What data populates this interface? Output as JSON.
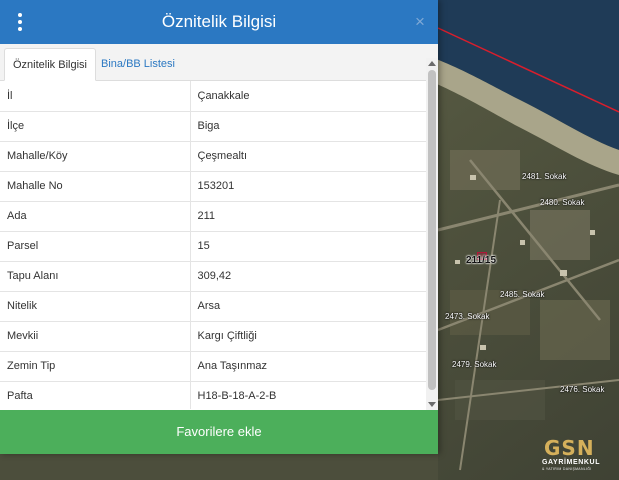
{
  "header": {
    "title": "Öznitelik Bilgisi",
    "menu_icon": "vertical-dots-icon",
    "close_icon": "close-icon",
    "close_glyph": "×",
    "color": "#2b78c2"
  },
  "tabs": [
    {
      "label": "Öznitelik Bilgisi",
      "active": true
    },
    {
      "label": "Bina/BB Listesi",
      "active": false
    }
  ],
  "attributes": [
    {
      "key": "İl",
      "value": "Çanakkale"
    },
    {
      "key": "İlçe",
      "value": "Biga"
    },
    {
      "key": "Mahalle/Köy",
      "value": "Çeşmealtı"
    },
    {
      "key": "Mahalle No",
      "value": "153201"
    },
    {
      "key": "Ada",
      "value": "211"
    },
    {
      "key": "Parsel",
      "value": "15"
    },
    {
      "key": "Tapu Alanı",
      "value": "309,42"
    },
    {
      "key": "Nitelik",
      "value": "Arsa"
    },
    {
      "key": "Mevkii",
      "value": "Kargı Çiftliği"
    },
    {
      "key": "Zemin Tip",
      "value": "Ana Taşınmaz"
    },
    {
      "key": "Pafta",
      "value": "H18-B-18-A-2-B"
    }
  ],
  "favorite_button": {
    "label": "Favorilere ekle",
    "color": "#4caf5b"
  },
  "map": {
    "parcel_label": "211/15",
    "street_labels": [
      "2481. Sokak",
      "2480. Sokak",
      "2473. Sokak",
      "2485. Sokak",
      "2476. Sokak",
      "2479. Sokak"
    ],
    "boundary_color": "#d81e2c",
    "sea_color": "#1f3b57"
  },
  "logo": {
    "mark": "GSN",
    "line1": "GAYRİMENKUL",
    "line2": "& YATIRIM DANIŞMANLIĞI"
  }
}
